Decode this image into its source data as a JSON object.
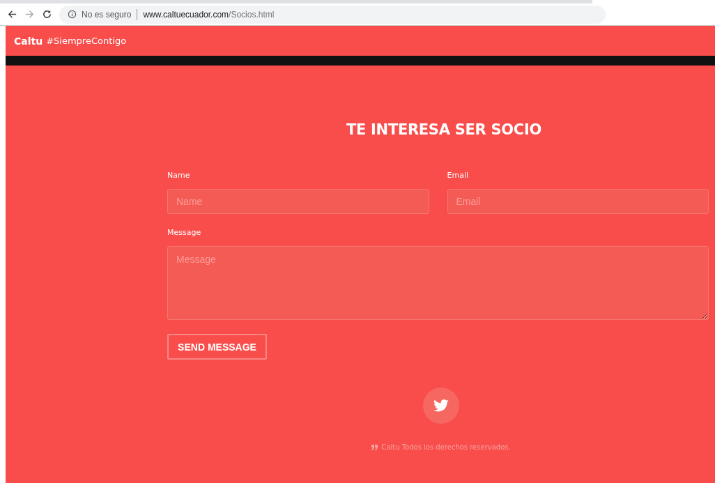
{
  "browser": {
    "security_label": "No es seguro",
    "url_host": "www.caltuecuador.com",
    "url_path": "/Socios.html"
  },
  "navbar": {
    "brand": "Caltu",
    "tagline": "#SiempreContigo"
  },
  "form": {
    "title": "TE INTERESA SER SOCIO",
    "fields": [
      {
        "kind": "input",
        "label": "Name",
        "placeholder": "Name"
      },
      {
        "kind": "input",
        "label": "Email",
        "placeholder": "Email"
      },
      {
        "kind": "textarea",
        "label": "Message",
        "placeholder": "Message"
      }
    ],
    "submit": "SEND MESSAGE"
  },
  "footer": {
    "copyright": "Caltu Todos los derechos reservados."
  }
}
